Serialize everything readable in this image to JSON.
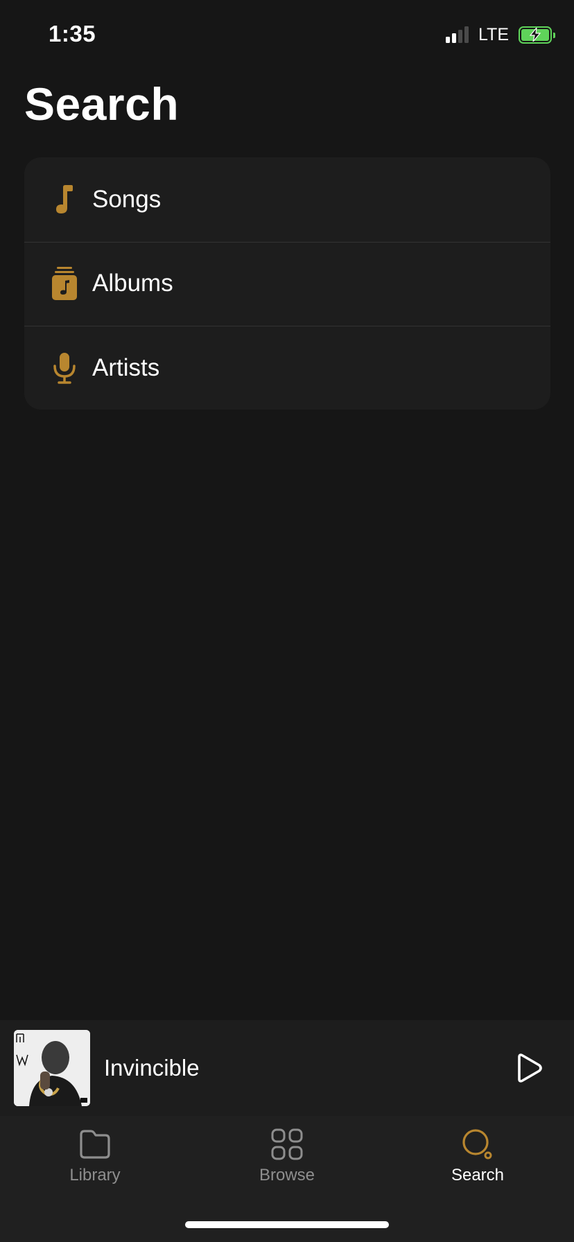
{
  "status_bar": {
    "time": "1:35",
    "network": "LTE",
    "signal_bars_active": 2,
    "signal_bars_total": 4,
    "battery_charging": true
  },
  "page": {
    "title": "Search"
  },
  "categories": [
    {
      "label": "Songs",
      "icon": "music-note-icon"
    },
    {
      "label": "Albums",
      "icon": "album-icon"
    },
    {
      "label": "Artists",
      "icon": "microphone-icon"
    }
  ],
  "mini_player": {
    "track_title": "Invincible",
    "artwork": "album-artwork",
    "play_icon": "play-icon"
  },
  "tab_bar": {
    "tabs": [
      {
        "label": "Library",
        "icon": "folder-icon",
        "active": false
      },
      {
        "label": "Browse",
        "icon": "grid-icon",
        "active": false
      },
      {
        "label": "Search",
        "icon": "search-icon",
        "active": true
      }
    ]
  },
  "colors": {
    "background": "#161616",
    "card": "#1d1d1d",
    "accent": "#b8862f",
    "battery": "#5fd35a",
    "inactive_tab": "#8e8e8e"
  }
}
